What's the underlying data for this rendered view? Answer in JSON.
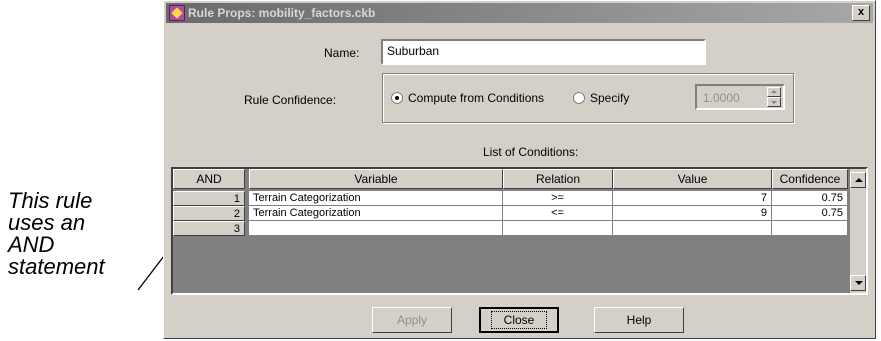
{
  "annotation": {
    "lines": [
      "This rule",
      "uses an",
      "AND",
      "statement"
    ]
  },
  "dialog": {
    "title": "Rule Props: mobility_factors.ckb",
    "close_glyph": "x",
    "name_label": "Name:",
    "name_value": "Suburban",
    "confidence_label": "Rule Confidence:",
    "radio_compute_label": "Compute from Conditions",
    "radio_compute_selected": true,
    "radio_specify_label": "Specify",
    "radio_specify_selected": false,
    "specify_value": "1.0000",
    "list_title": "List of Conditions:",
    "table": {
      "operator": "AND",
      "columns": [
        "Variable",
        "Relation",
        "Value",
        "Confidence"
      ],
      "rows": [
        {
          "num": "1",
          "variable": "Terrain Categorization",
          "relation": ">=",
          "value": "7",
          "confidence": "0.75"
        },
        {
          "num": "2",
          "variable": "Terrain Categorization",
          "relation": "<=",
          "value": "9",
          "confidence": "0.75"
        },
        {
          "num": "3",
          "variable": "",
          "relation": "",
          "value": "",
          "confidence": ""
        }
      ]
    },
    "buttons": {
      "apply": "Apply",
      "close": "Close",
      "help": "Help"
    }
  }
}
